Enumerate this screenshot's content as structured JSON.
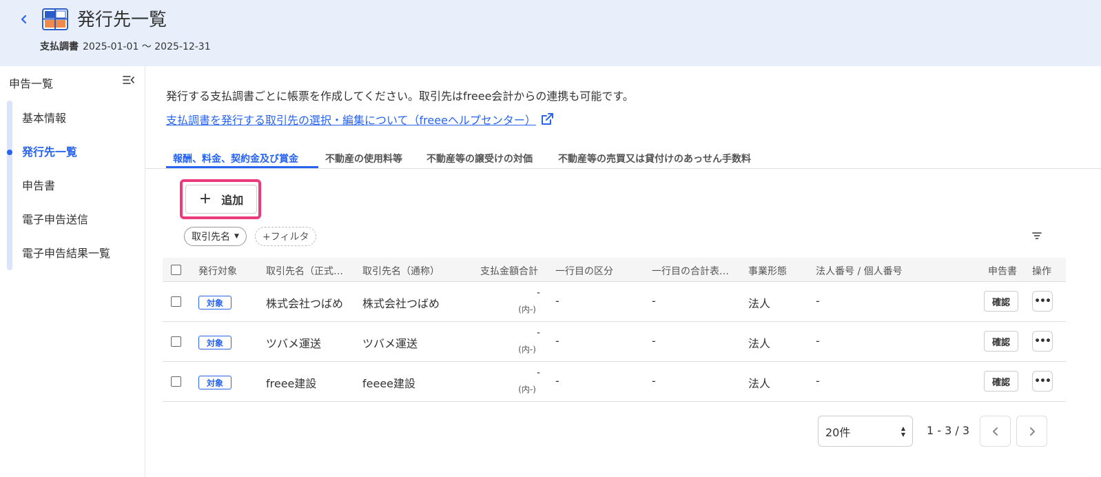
{
  "header": {
    "title": "発行先一覧",
    "subtitle_label": "支払調書",
    "subtitle_period": "2025-01-01 ～ 2025-12-31",
    "back_icon": "chevron-left-icon",
    "app_icon": "payment-report-icon",
    "background": "#e9effa"
  },
  "sidebar": {
    "title": "申告一覧",
    "collapse_icon": "collapse-sidebar-icon",
    "items": [
      {
        "label": "基本情報"
      },
      {
        "label": "発行先一覧",
        "active": true
      },
      {
        "label": "申告書"
      },
      {
        "label": "電子申告送信"
      },
      {
        "label": "電子申告結果一覧"
      }
    ]
  },
  "main": {
    "description": "発行する支払調書ごとに帳票を作成してください。取引先はfreee会計からの連携も可能です。",
    "help_link": "支払調書を発行する取引先の選択・編集について（freeeヘルプセンター）",
    "tabs": [
      {
        "label": "報酬、料金、契約金及び賞金",
        "active": true
      },
      {
        "label": "不動産の使用料等"
      },
      {
        "label": "不動産等の譲受けの対価"
      },
      {
        "label": "不動産等の売買又は貸付けのあっせん手数料"
      }
    ],
    "add_button": "追加",
    "filters": {
      "name_chip": "取引先名",
      "add_filter": "+フィルタ"
    }
  },
  "table": {
    "columns": [
      "発行対象",
      "取引先名（正式…",
      "取引先名（通称）",
      "支払金額合計",
      "一行目の区分",
      "一行目の合計表…",
      "事業形態",
      "法人番号 / 個人番号",
      "申告書",
      "操作"
    ],
    "rows": [
      {
        "target": "対象",
        "official_name": "株式会社つばめ",
        "common_name": "株式会社つばめ",
        "amount": "-",
        "amount_sub": "(内-)",
        "first_category": "-",
        "first_total": "-",
        "business_type": "法人",
        "corp_number": "-",
        "report_button": "確認"
      },
      {
        "target": "対象",
        "official_name": "ツバメ運送",
        "common_name": "ツバメ運送",
        "amount": "-",
        "amount_sub": "(内-)",
        "first_category": "-",
        "first_total": "-",
        "business_type": "法人",
        "corp_number": "-",
        "report_button": "確認"
      },
      {
        "target": "対象",
        "official_name": "freee建設",
        "common_name": "feeee建設",
        "amount": "-",
        "amount_sub": "(内-)",
        "first_category": "-",
        "first_total": "-",
        "business_type": "法人",
        "corp_number": "-",
        "report_button": "確認"
      }
    ]
  },
  "pagination": {
    "per_page": "20件",
    "range": "1 - 3 / 3"
  },
  "colors": {
    "accent": "#2864f0",
    "highlight": "#ec3a7c"
  }
}
